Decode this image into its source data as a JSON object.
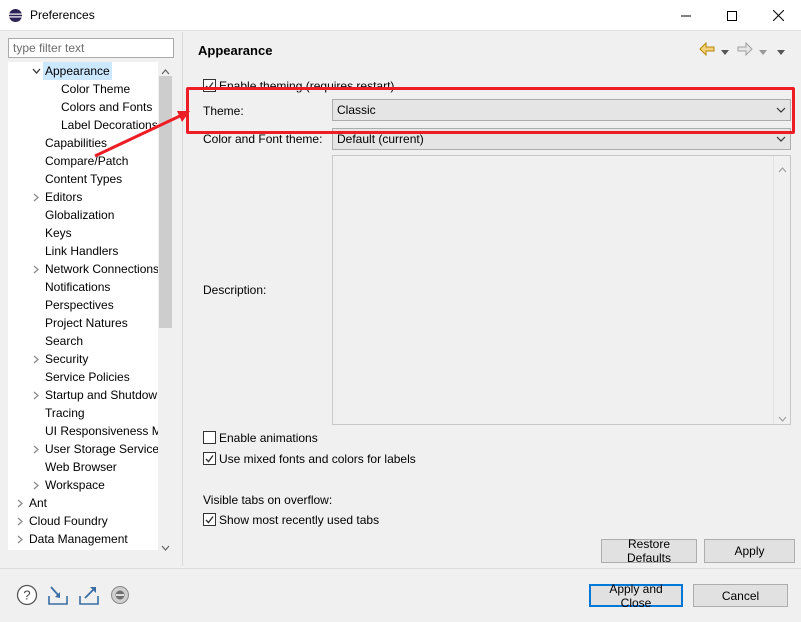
{
  "window": {
    "title": "Preferences"
  },
  "filter": {
    "placeholder": "type filter text"
  },
  "tree": [
    {
      "label": "Appearance",
      "level": 1,
      "expanded": true,
      "selected": true
    },
    {
      "label": "Color Theme",
      "level": 2
    },
    {
      "label": "Colors and Fonts",
      "level": 2
    },
    {
      "label": "Label Decorations",
      "level": 2
    },
    {
      "label": "Capabilities",
      "level": 1
    },
    {
      "label": "Compare/Patch",
      "level": 1
    },
    {
      "label": "Content Types",
      "level": 1
    },
    {
      "label": "Editors",
      "level": 1,
      "collapsed": true
    },
    {
      "label": "Globalization",
      "level": 1
    },
    {
      "label": "Keys",
      "level": 1
    },
    {
      "label": "Link Handlers",
      "level": 1
    },
    {
      "label": "Network Connections",
      "level": 1,
      "collapsed": true
    },
    {
      "label": "Notifications",
      "level": 1
    },
    {
      "label": "Perspectives",
      "level": 1
    },
    {
      "label": "Project Natures",
      "level": 1
    },
    {
      "label": "Search",
      "level": 1
    },
    {
      "label": "Security",
      "level": 1,
      "collapsed": true
    },
    {
      "label": "Service Policies",
      "level": 1
    },
    {
      "label": "Startup and Shutdown",
      "level": 1,
      "collapsed": true
    },
    {
      "label": "Tracing",
      "level": 1
    },
    {
      "label": "UI Responsiveness Monitoring",
      "level": 1
    },
    {
      "label": "User Storage Service",
      "level": 1,
      "collapsed": true
    },
    {
      "label": "Web Browser",
      "level": 1
    },
    {
      "label": "Workspace",
      "level": 1,
      "collapsed": true
    },
    {
      "label": "Ant",
      "level": 0,
      "collapsed": true
    },
    {
      "label": "Cloud Foundry",
      "level": 0,
      "collapsed": true
    },
    {
      "label": "Data Management",
      "level": 0,
      "collapsed": true
    }
  ],
  "page": {
    "title": "Appearance",
    "enable_theming": {
      "label": "Enable theming (requires restart)",
      "checked": true
    },
    "theme_label": "Theme:",
    "theme_value": "Classic",
    "color_font_theme_label": "Color and Font theme:",
    "color_font_theme_value": "Default (current)",
    "description_label": "Description:",
    "enable_animations": {
      "label": "Enable animations",
      "checked": false
    },
    "mixed_fonts": {
      "label": "Use mixed fonts and colors for labels",
      "checked": true
    },
    "visible_tabs_label": "Visible tabs on overflow:",
    "show_recent_tabs": {
      "label": "Show most recently used tabs",
      "checked": true
    }
  },
  "buttons": {
    "restore_defaults": "Restore Defaults",
    "apply": "Apply",
    "apply_and_close": "Apply and Close",
    "cancel": "Cancel"
  },
  "colors": {
    "highlight": "#ee1c24",
    "selection": "#cce8ff",
    "primary_border": "#0078d7"
  },
  "icons": [
    "help-icon",
    "import-icon",
    "export-icon",
    "oomph-icon",
    "back-arrow-icon",
    "forward-arrow-icon"
  ]
}
